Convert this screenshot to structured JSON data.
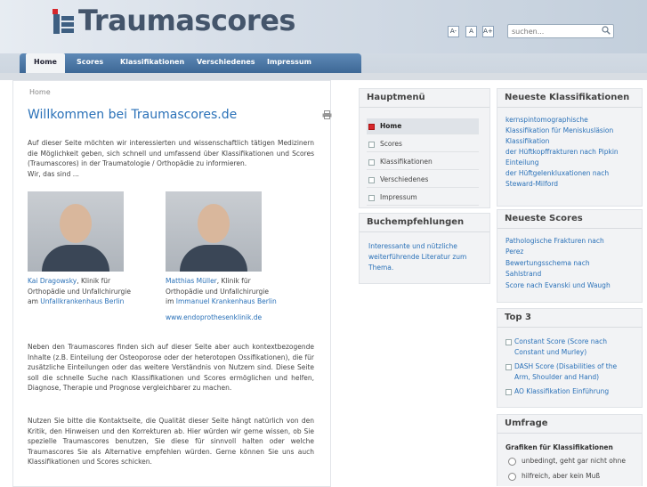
{
  "header": {
    "logo_text": "Traumascores",
    "font_sizes": [
      "A-",
      "A",
      "A+"
    ],
    "search_placeholder": "suchen..."
  },
  "nav": [
    "Home",
    "Scores",
    "Klassifikationen",
    "Verschiedenes",
    "Impressum"
  ],
  "breadcrumb": "Home",
  "main": {
    "title": "Willkommen bei Traumascores.de",
    "intro": "Auf dieser Seite möchten wir interessierten und wissenschaftlich tätigen Medizinern die Möglichkeit geben, sich schnell und umfassend über Klassifikationen und Scores (Traumascores) in der Traumatologie / Orthopädie zu informieren.",
    "intro2": "Wir, das sind ...",
    "person1": {
      "name": "Kai Dragowsky",
      "role1": ", Klinik für",
      "role2": "Orthopädie und Unfallchirurgie",
      "am": "am ",
      "clinic": "Unfallkrankenhaus Berlin"
    },
    "person2": {
      "name": "Matthias Müller",
      "role1": ", Klinik für",
      "role2": "Orthopädie und Unfallchirurgie",
      "am": "im ",
      "clinic": "Immanuel Krankenhaus Berlin",
      "web": "www.endoprothesenklinik.de"
    },
    "para2": "Neben den Traumascores finden sich auf dieser Seite aber auch kontextbezogende Inhalte (z.B. Einteilung der Osteoporose oder der heterotopen Ossifikationen), die für zusätzliche Einteilungen oder das weitere Verständnis von Nutzem sind. Diese Seite soll die schnelle Suche nach Klassifikationen und Scores ermöglichen und helfen, Diagnose, Therapie und Prognose vergleichbarer zu machen.",
    "para3": "Nutzen Sie bitte die Kontaktseite, die Qualität dieser Seite hängt natürlich von den Kritik, den Hinweisen und den Korrekturen ab. Hier würden wir gerne wissen, ob Sie spezielle Traumascores benutzen, Sie diese für sinnvoll halten oder welche Traumascores Sie als Alternative empfehlen würden. Gerne können Sie uns auch Klassifikationen und Scores schicken."
  },
  "hauptmenu": {
    "title": "Hauptmenü",
    "items": [
      "Home",
      "Scores",
      "Klassifikationen",
      "Verschiedenes",
      "Impressum"
    ]
  },
  "buch": {
    "title": "Buchempfehlungen",
    "text": [
      "Interessante und nützliche",
      "weiterführende Literatur zum",
      "Thema."
    ]
  },
  "neueste_klass": {
    "title": "Neueste Klassifikationen",
    "lines": [
      "kernspintomographische",
      "Klassifikation für Meniskusläsion",
      "Klassifikation",
      "der Hüftkopffrakturen nach Pipkin",
      "Einteilung",
      "der Hüftgelenkluxationen nach",
      "Steward-Milford"
    ]
  },
  "neueste_scores": {
    "title": "Neueste Scores",
    "lines": [
      "Pathologische Frakturen nach",
      "Perez",
      "Bewertungsschema nach",
      "Sahlstrand",
      "Score nach Evanski und Waugh"
    ]
  },
  "top3": {
    "title": "Top 3",
    "items": [
      [
        "Constant Score (Score nach",
        "Constant und Murley)"
      ],
      [
        "DASH Score (Disabilities of the",
        "Arm, Shoulder and Hand)"
      ],
      [
        "AO Klassifikation Einführung"
      ]
    ]
  },
  "umfrage": {
    "title": "Umfrage",
    "question": "Grafiken für Klassifikationen",
    "options": [
      "unbedingt, geht gar nicht ohne",
      "hilfreich, aber kein Muß"
    ]
  }
}
